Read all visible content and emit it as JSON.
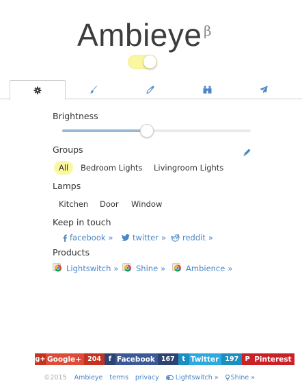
{
  "header": {
    "title": "Ambieye",
    "beta": "β",
    "power_on": true
  },
  "tabs": [
    {
      "id": "settings",
      "icon": "gear-icon",
      "active": true
    },
    {
      "id": "brush",
      "icon": "brush-icon",
      "active": false
    },
    {
      "id": "eyedropper",
      "icon": "eyedropper-icon",
      "active": false
    },
    {
      "id": "binoculars",
      "icon": "binoculars-icon",
      "active": false
    },
    {
      "id": "send",
      "icon": "send-icon",
      "active": false
    }
  ],
  "brightness": {
    "label": "Brightness",
    "value_percent": 45
  },
  "groups": {
    "label": "Groups",
    "items": [
      "All",
      "Bedroom Lights",
      "Livingroom Lights"
    ],
    "selected": "All"
  },
  "lamps": {
    "label": "Lamps",
    "items": [
      "Kitchen",
      "Door",
      "Window"
    ]
  },
  "keep_in_touch": {
    "label": "Keep in touch",
    "links": [
      {
        "label": "facebook",
        "arrow": "»",
        "icon": "facebook-icon"
      },
      {
        "label": "twitter",
        "arrow": "»",
        "icon": "twitter-icon"
      },
      {
        "label": "reddit",
        "arrow": "»",
        "icon": "reddit-icon"
      }
    ]
  },
  "products": {
    "label": "Products",
    "links": [
      {
        "label": "Lightswitch",
        "arrow": "»",
        "icon": "chrome-icon"
      },
      {
        "label": "Shine",
        "arrow": "»",
        "icon": "chrome-icon"
      },
      {
        "label": "Ambience",
        "arrow": "»",
        "icon": "chrome-icon"
      }
    ]
  },
  "share": [
    {
      "icon": "google-plus-icon",
      "glyph": "g+",
      "label": "Google+",
      "count": "204",
      "color": "#dd4b39",
      "count_color": "#c23321"
    },
    {
      "icon": "facebook-icon",
      "glyph": "f",
      "label": "Facebook",
      "count": "167",
      "color": "#3b5998",
      "count_color": "#2d4373"
    },
    {
      "icon": "twitter-icon",
      "glyph": "t",
      "label": "Twitter",
      "count": "197",
      "color": "#2ba9e1",
      "count_color": "#1c8fc2"
    },
    {
      "icon": "pinterest-icon",
      "glyph": "P",
      "label": "Pinterest",
      "count": "",
      "color": "#cb2027",
      "count_color": "#cb2027"
    }
  ],
  "footer": {
    "copyright": "©2015",
    "links": [
      "Ambieye",
      "terms",
      "privacy"
    ],
    "lightswitch": "Lightswitch »",
    "shine": "Shine »"
  },
  "colors": {
    "accent_blue": "#4a86c5",
    "toggle_yellow": "#fbf7a0",
    "slider_fill": "#9ab8d2"
  }
}
